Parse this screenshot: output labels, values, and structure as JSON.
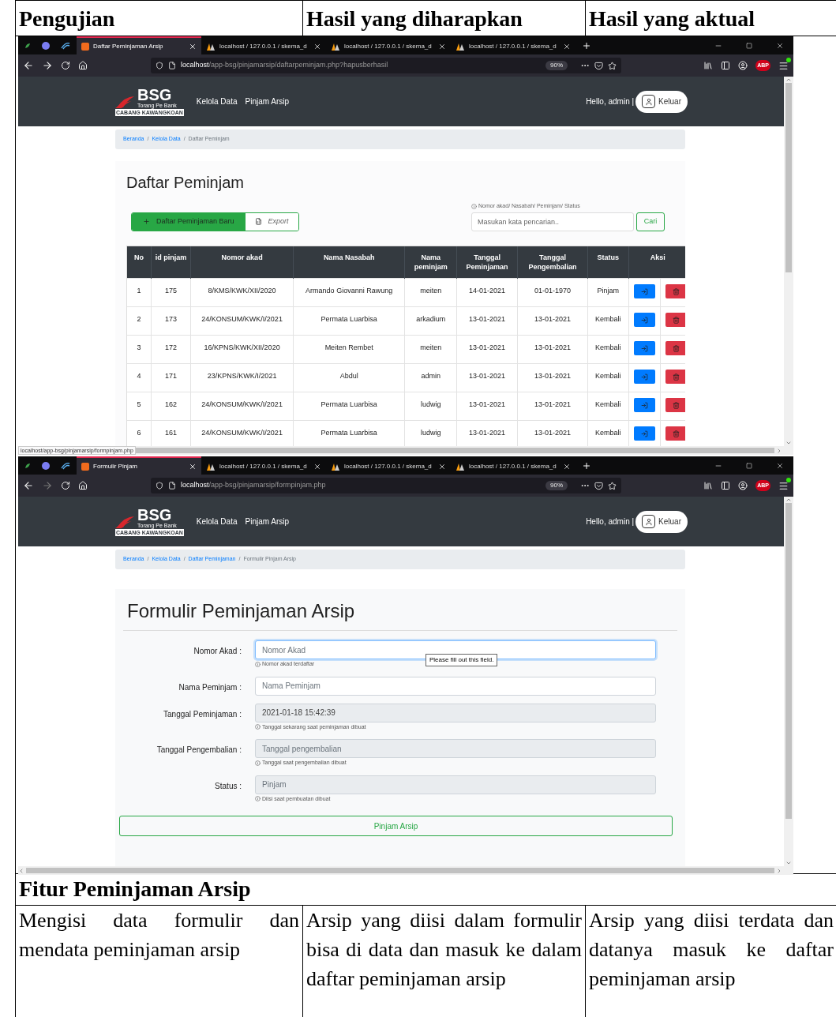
{
  "doc_header": [
    "Pengujian",
    "Hasil yang diharapkan",
    "Hasil yang aktual"
  ],
  "screenshots": [
    {
      "tabs": [
        {
          "label": "Daftar Peminjaman Arsip",
          "kind": "app",
          "selected": true
        },
        {
          "label": "localhost / 127.0.0.1 / skema_d",
          "kind": "pma",
          "selected": false
        },
        {
          "label": "localhost / 127.0.0.1 / skema_d",
          "kind": "pma",
          "selected": false
        },
        {
          "label": "localhost / 127.0.0.1 / skema_d",
          "kind": "pma",
          "selected": false
        }
      ],
      "forward_disabled": false,
      "url": {
        "host": "localhost",
        "path": "/app-bsg/pinjamarsip/daftarpeminjam.php?hapusberhasil"
      },
      "zoom": "90%",
      "abp": "ABP",
      "breadcrumb_separator": "/",
      "page": {
        "kind": "list",
        "navbar": {
          "logo": "BSG",
          "tagline": "Torang Pe Bank",
          "branch": "CABANG KAWANGKOAN",
          "links": [
            "Kelola Data",
            "Pinjam Arsip"
          ],
          "greeting": "Hello, admin |",
          "logout": "Keluar"
        },
        "breadcrumb": [
          {
            "label": "Beranda",
            "active": false
          },
          {
            "label": "Kelola Data",
            "active": false
          },
          {
            "label": "Daftar Peminjam",
            "active": true
          }
        ],
        "title": "Daftar Peminjam",
        "add_button": "Daftar Peminjaman Baru",
        "export_button": "Export",
        "search": {
          "hint": "Nomor akad/ Nasabah/ Peminjam/ Status",
          "placeholder": "Masukan kata pencarian..",
          "button": "Cari"
        },
        "table": {
          "columns": [
            "No",
            "id pinjam",
            "Nomor akad",
            "Nama Nasabah",
            "Nama peminjam",
            "Tanggal Peminjaman",
            "Tanggal Pengembalian",
            "Status",
            "Aksi"
          ],
          "rows": [
            [
              "1",
              "175",
              "8/KMS/KWK/XII/2020",
              "Armando Giovanni Rawung",
              "meiten",
              "14-01-2021",
              "01-01-1970",
              "Pinjam"
            ],
            [
              "2",
              "173",
              "24/KONSUM/KWK/I/2021",
              "Permata Luarbisa",
              "arkadium",
              "13-01-2021",
              "13-01-2021",
              "Kembali"
            ],
            [
              "3",
              "172",
              "16/KPNS/KWK/XII/2020",
              "Meiten Rembet",
              "meiten",
              "13-01-2021",
              "13-01-2021",
              "Kembali"
            ],
            [
              "4",
              "171",
              "23/KPNS/KWK/I/2021",
              "Abdul",
              "admin",
              "13-01-2021",
              "13-01-2021",
              "Kembali"
            ],
            [
              "5",
              "162",
              "24/KONSUM/KWK/I/2021",
              "Permata Luarbisa",
              "ludwig",
              "13-01-2021",
              "13-01-2021",
              "Kembali"
            ],
            [
              "6",
              "161",
              "24/KONSUM/KWK/I/2021",
              "Permata Luarbisa",
              "ludwig",
              "13-01-2021",
              "13-01-2021",
              "Kembali"
            ]
          ]
        }
      },
      "status_link": "localhost/app-bsg/pinjamarsip/formpinjam.php"
    },
    {
      "tabs": [
        {
          "label": "Formulir Pinjam",
          "kind": "app",
          "selected": true
        },
        {
          "label": "localhost / 127.0.0.1 / skema_d",
          "kind": "pma",
          "selected": false
        },
        {
          "label": "localhost / 127.0.0.1 / skema_d",
          "kind": "pma",
          "selected": false
        },
        {
          "label": "localhost / 127.0.0.1 / skema_d",
          "kind": "pma",
          "selected": false
        }
      ],
      "forward_disabled": true,
      "url": {
        "host": "localhost",
        "path": "/app-bsg/pinjamarsip/formpinjam.php"
      },
      "zoom": "90%",
      "abp": "ABP",
      "breadcrumb_separator": "/",
      "page": {
        "kind": "form",
        "navbar": {
          "logo": "BSG",
          "tagline": "Torang Pe Bank",
          "branch": "CABANG KAWANGKOAN",
          "links": [
            "Kelola Data",
            "Pinjam Arsip"
          ],
          "greeting": "Hello, admin |",
          "logout": "Keluar"
        },
        "breadcrumb": [
          {
            "label": "Beranda",
            "active": false
          },
          {
            "label": "Kelola Data",
            "active": false
          },
          {
            "label": "Daftar Peminjaman",
            "active": false
          },
          {
            "label": "Formulir Pinjam Arsip",
            "active": true
          }
        ],
        "title": "Formulir Peminjaman Arsip",
        "fields": [
          {
            "label": "Nomor Akad :",
            "placeholder": "Nomor Akad",
            "help": "Nomor akad terdaftar",
            "disabled": false,
            "focused": true,
            "tooltip": "Please fill out this field."
          },
          {
            "label": "Nama Peminjam :",
            "placeholder": "Nama Peminjam",
            "disabled": false,
            "focused": false
          },
          {
            "label": "Tanggal Peminjaman :",
            "value": "2021-01-18 15:42:39",
            "help": "Tanggal sekarang saat peminjaman dibuat",
            "disabled": true,
            "focused": false
          },
          {
            "label": "Tanggal Pengembalian :",
            "placeholder": "Tanggal pengembalian",
            "help": "Tanggal saat pengembalian dibuat",
            "disabled": true,
            "focused": false
          },
          {
            "label": "Status :",
            "placeholder": "Pinjam",
            "help": "Diisi saat pembuatan dibuat",
            "disabled": true,
            "focused": false
          }
        ],
        "submit": "Pinjam Arsip"
      }
    }
  ],
  "section_title": "Fitur Peminjaman Arsip",
  "doc_row": [
    "Mengisi data formulir dan mendata peminjaman arsip",
    "Arsip yang diisi dalam formulir bisa di data dan masuk ke dalam daftar peminjaman arsip",
    "Arsip yang diisi terdata dan datanya masuk ke daftar peminjaman arsip"
  ]
}
